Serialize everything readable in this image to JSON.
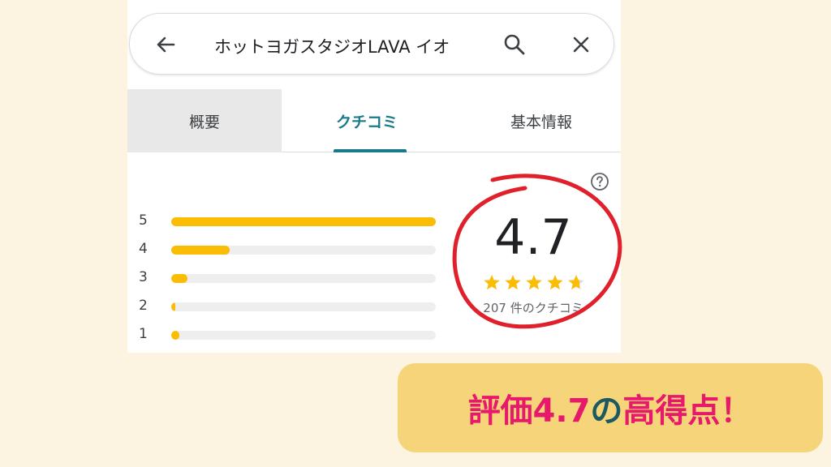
{
  "search": {
    "query": "ホットヨガスタジオLAVA イオ",
    "icons": [
      "arrow-back-icon",
      "search-icon",
      "close-icon"
    ]
  },
  "tabs": [
    {
      "label": "概要",
      "selected": false
    },
    {
      "label": "クチコミ",
      "selected": true
    },
    {
      "label": "基本情報",
      "selected": false
    }
  ],
  "ratings": {
    "score": "4.7",
    "stars": 4.7,
    "review_count_text": "207 件のクチコミ",
    "distribution": [
      {
        "star": "5",
        "fraction": 1.0
      },
      {
        "star": "4",
        "fraction": 0.22
      },
      {
        "star": "3",
        "fraction": 0.06
      },
      {
        "star": "2",
        "fraction": 0.01
      },
      {
        "star": "1",
        "fraction": 0.03
      }
    ]
  },
  "banner": {
    "part1": "評価4.7",
    "part2": "の",
    "part3": "高得点！"
  },
  "colors": {
    "bar": "#fbbc04",
    "accent_tab": "#1a7a8c",
    "annotation_circle": "#e0202a",
    "banner_bg": "#f6d57a",
    "banner_pink": "#e6196a",
    "banner_teal": "#1a5a60",
    "page_bg": "#fdf3e1"
  }
}
